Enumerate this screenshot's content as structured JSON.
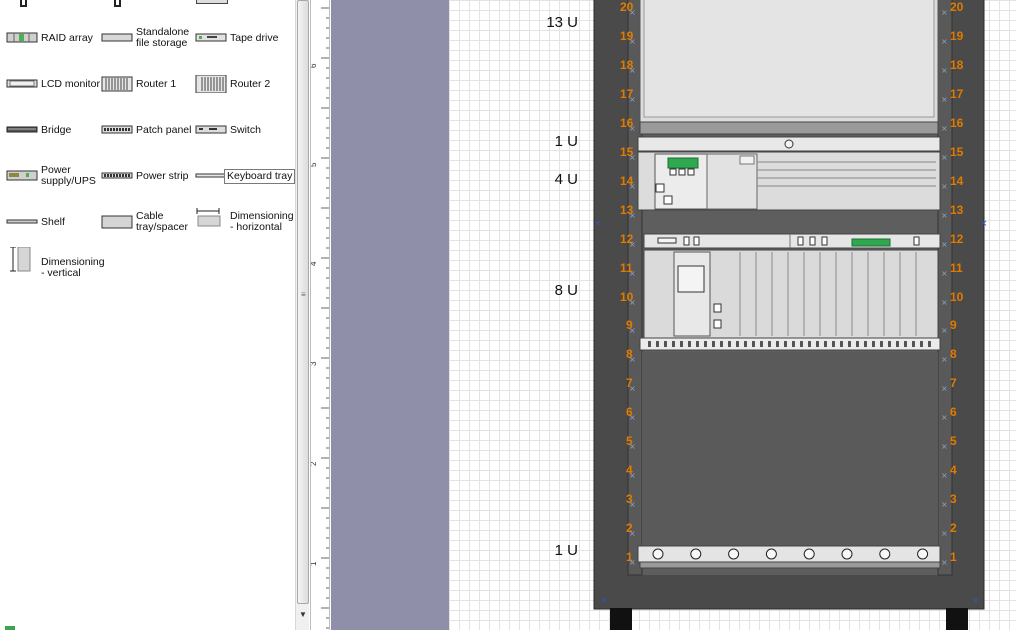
{
  "stencil": {
    "shapes": [
      {
        "name": "RAID array",
        "lines": [
          "RAID array"
        ],
        "icon": "raid-array-icon"
      },
      {
        "name": "Standalone file storage",
        "lines": [
          "Standalone",
          "file storage"
        ],
        "icon": "file-storage-icon"
      },
      {
        "name": "Tape drive",
        "lines": [
          "Tape drive"
        ],
        "icon": "tape-drive-icon"
      },
      {
        "name": "LCD monitor",
        "lines": [
          "LCD monitor"
        ],
        "icon": "lcd-monitor-icon"
      },
      {
        "name": "Router 1",
        "lines": [
          "Router 1"
        ],
        "icon": "router-1-icon"
      },
      {
        "name": "Router 2",
        "lines": [
          "Router 2"
        ],
        "icon": "router-2-icon"
      },
      {
        "name": "Bridge",
        "lines": [
          "Bridge"
        ],
        "icon": "bridge-icon"
      },
      {
        "name": "Patch panel",
        "lines": [
          "Patch panel"
        ],
        "icon": "patch-panel-icon"
      },
      {
        "name": "Switch",
        "lines": [
          "Switch"
        ],
        "icon": "switch-icon"
      },
      {
        "name": "Power supply/UPS",
        "lines": [
          "Power",
          "supply/UPS"
        ],
        "icon": "ups-icon"
      },
      {
        "name": "Power strip",
        "lines": [
          "Power strip"
        ],
        "icon": "power-strip-icon"
      },
      {
        "name": "Keyboard tray",
        "lines": [
          "Keyboard tray"
        ],
        "icon": "keyboard-tray-icon"
      },
      {
        "name": "Shelf",
        "lines": [
          "Shelf"
        ],
        "icon": "shelf-icon"
      },
      {
        "name": "Cable tray/spacer",
        "lines": [
          "Cable",
          "tray/spacer"
        ],
        "icon": "cable-tray-icon"
      },
      {
        "name": "Dimensioning - horizontal",
        "lines": [
          "Dimensioning",
          "- horizontal"
        ],
        "icon": "dimension-horizontal-icon"
      },
      {
        "name": "Dimensioning - vertical",
        "lines": [
          "Dimensioning",
          "- vertical"
        ],
        "icon": "dimension-vertical-icon"
      }
    ]
  },
  "ruler": {
    "labels": [
      "6",
      "5",
      "4",
      "3",
      "2",
      "1"
    ]
  },
  "rack": {
    "unit_numbers": [
      "20",
      "19",
      "18",
      "17",
      "16",
      "15",
      "14",
      "13",
      "12",
      "11",
      "10",
      "9",
      "8",
      "7",
      "6",
      "5",
      "4",
      "3",
      "2",
      "1"
    ],
    "dimension_labels": [
      "13 U",
      "1 U",
      "4 U",
      "8 U",
      "1 U"
    ],
    "colors": {
      "frame": "#4a4a4a",
      "rail_numbers": "#e07b00",
      "equipment": "#dcdcdc",
      "status_green": "#2fa84f"
    }
  }
}
